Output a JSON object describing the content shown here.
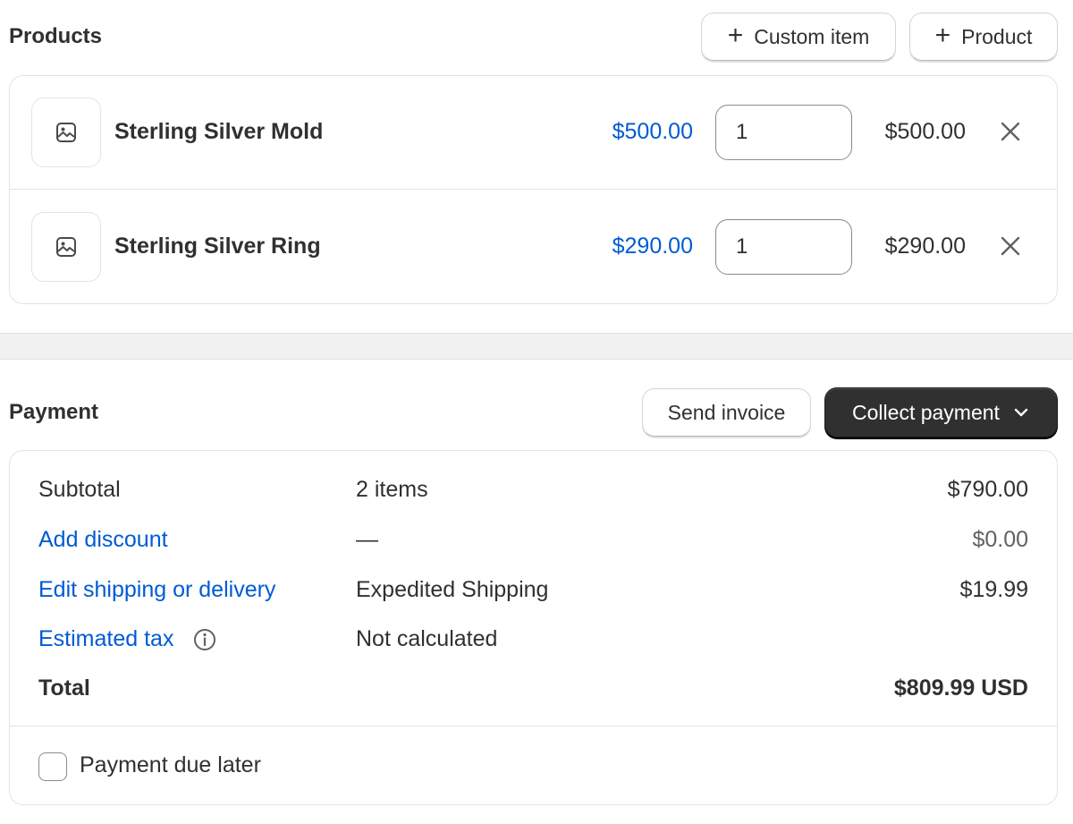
{
  "products": {
    "title": "Products",
    "custom_item_label": "Custom item",
    "product_label": "Product",
    "items": [
      {
        "name": "Sterling Silver Mold",
        "unit_price": "$500.00",
        "quantity": "1",
        "line_total": "$500.00"
      },
      {
        "name": "Sterling Silver Ring",
        "unit_price": "$290.00",
        "quantity": "1",
        "line_total": "$290.00"
      }
    ]
  },
  "payment": {
    "title": "Payment",
    "send_invoice_label": "Send invoice",
    "collect_payment_label": "Collect payment",
    "subtotal": {
      "label": "Subtotal",
      "detail": "2 items",
      "amount": "$790.00"
    },
    "discount": {
      "label": "Add discount",
      "detail": "—",
      "amount": "$0.00"
    },
    "shipping": {
      "label": "Edit shipping or delivery",
      "detail": "Expedited Shipping",
      "amount": "$19.99"
    },
    "tax": {
      "label": "Estimated tax",
      "detail": "Not calculated"
    },
    "total": {
      "label": "Total",
      "amount": "$809.99 USD"
    },
    "payment_due_later_label": "Payment due later",
    "payment_due_later_checked": false
  },
  "colors": {
    "link": "#005bd3",
    "text": "#303030",
    "primary_button": "#303030",
    "border": "#e3e3e3"
  },
  "icons": {
    "thumbnail": "image-placeholder-icon",
    "add": "plus-icon",
    "remove": "close-icon",
    "dropdown": "chevron-down-icon",
    "info": "info-icon"
  }
}
